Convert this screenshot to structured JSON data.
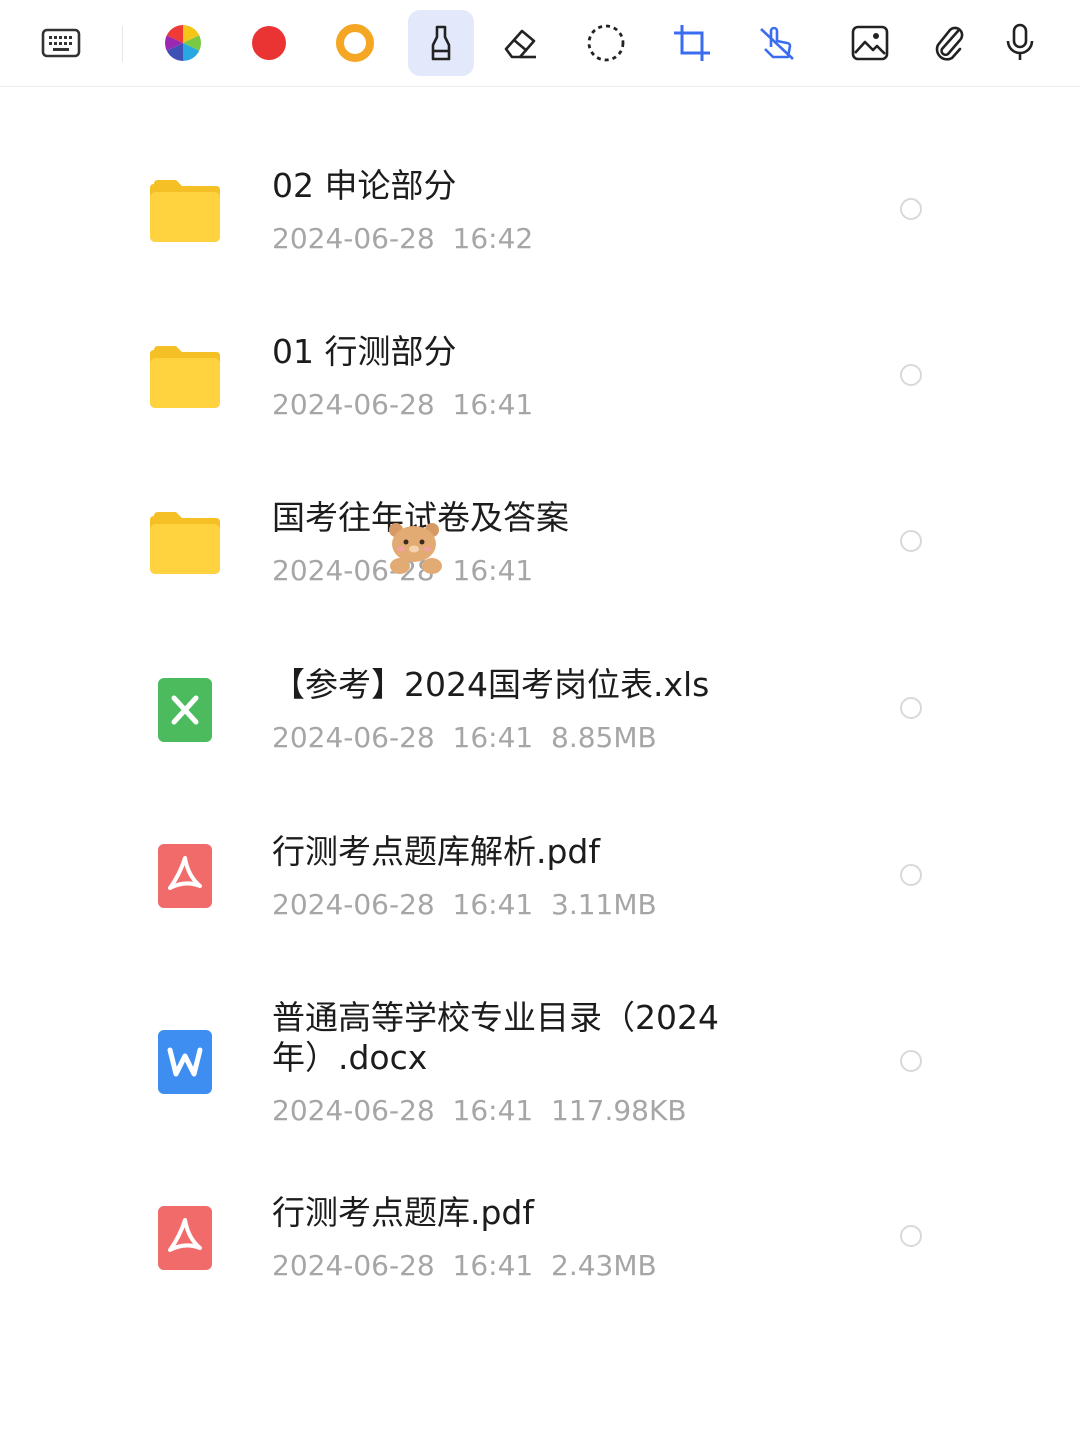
{
  "toolbar": {
    "tools": [
      {
        "icon": "keyboard-icon",
        "active": false
      },
      {
        "icon": "color-wheel-icon",
        "active": false
      },
      {
        "icon": "red-dot-icon",
        "active": false,
        "color": "#ea3434"
      },
      {
        "icon": "orange-ring-icon",
        "active": false,
        "color": "#f5a623"
      },
      {
        "icon": "highlighter-icon",
        "active": true
      },
      {
        "icon": "eraser-icon",
        "active": false
      },
      {
        "icon": "lasso-select-icon",
        "active": false
      },
      {
        "icon": "crop-icon",
        "active": false,
        "color": "#3a6cf0"
      },
      {
        "icon": "touch-pen-off-icon",
        "active": false,
        "color": "#3a6cf0"
      },
      {
        "icon": "image-icon",
        "active": false
      },
      {
        "icon": "attachment-icon",
        "active": false
      },
      {
        "icon": "microphone-icon",
        "active": false
      }
    ]
  },
  "files": [
    {
      "type": "folder",
      "name": "02 申论部分",
      "meta": "2024-06-28  16:42"
    },
    {
      "type": "folder",
      "name": "01 行测部分",
      "meta": "2024-06-28  16:41"
    },
    {
      "type": "folder",
      "name": "国考往年试卷及答案",
      "meta": "2024-06-28  16:41"
    },
    {
      "type": "xls",
      "name": "【参考】2024国考岗位表.xls",
      "meta": "2024-06-28  16:41  8.85MB"
    },
    {
      "type": "pdf",
      "name": "行测考点题库解析.pdf",
      "meta": "2024-06-28  16:41  3.11MB"
    },
    {
      "type": "docx",
      "name": "普通高等学校专业目录（2024年）.docx",
      "meta": "2024-06-28  16:41  117.98KB"
    },
    {
      "type": "pdf",
      "name": "行测考点题库.pdf",
      "meta": "2024-06-28  16:41  2.43MB"
    }
  ],
  "colors": {
    "folder": "#ffd23f",
    "xls": "#4cbb5e",
    "pdf": "#f26b6b",
    "docx": "#3d8ef0"
  }
}
